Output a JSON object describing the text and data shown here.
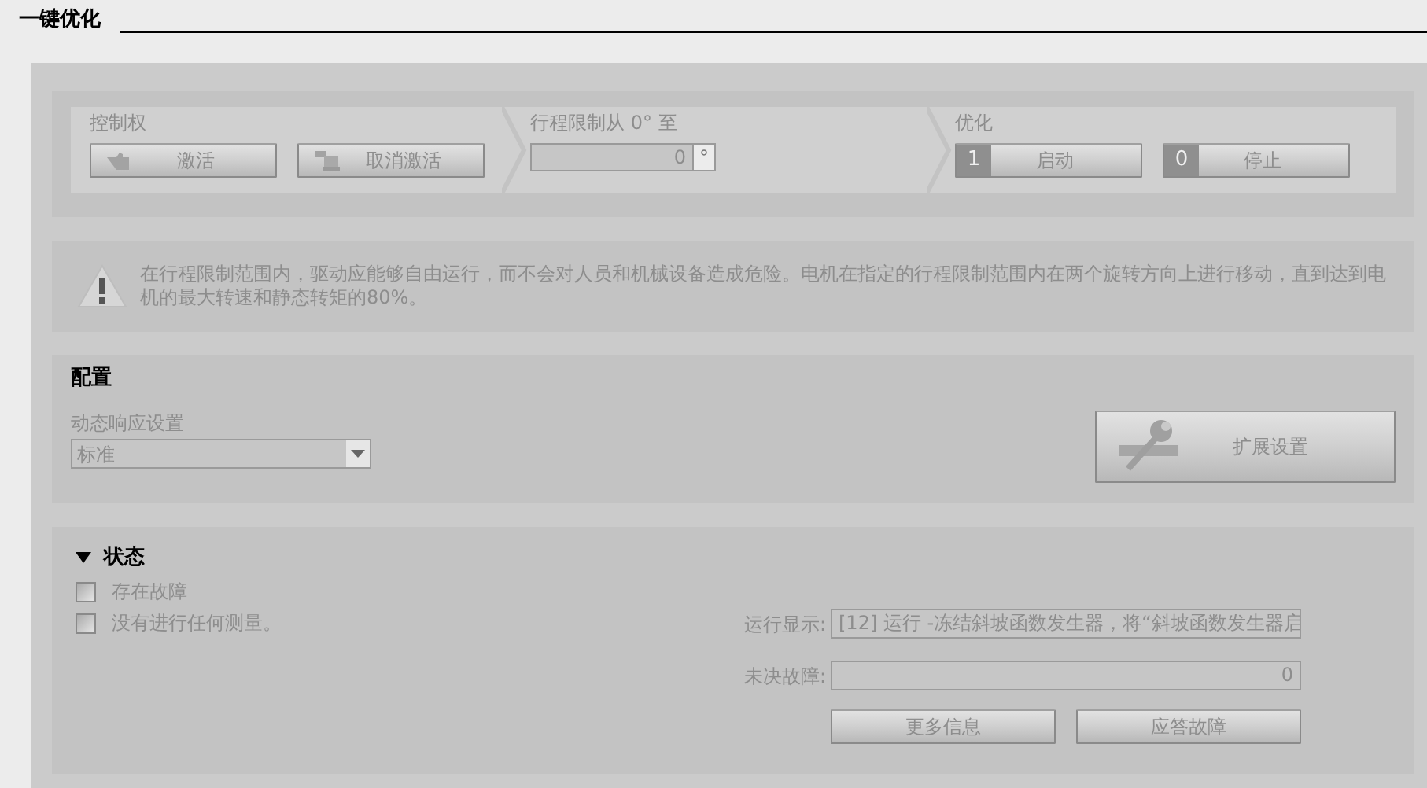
{
  "title": "一键优化",
  "steps": [
    {
      "kind": "buttons",
      "label": "控制权",
      "buttons": [
        {
          "label": "激活"
        },
        {
          "label": "取消激活"
        }
      ]
    },
    {
      "kind": "field",
      "label": "行程限制从 0° 至",
      "value": "0",
      "unit": "°"
    },
    {
      "kind": "buttons",
      "label": "优化",
      "buttons": [
        {
          "label": "启动",
          "number": "1"
        },
        {
          "label": "停止",
          "number": "0"
        }
      ]
    }
  ],
  "warning": "在行程限制范围内，驱动应能够自由运行，而不会对人员和机械设备造成危险。电机在指定的行程限制范围内在两个旋转方向上进行移动，直到达到电机的最大转速和静态转矩的80%。",
  "config": {
    "title": "配置",
    "dropdown_label": "动态响应设置",
    "dropdown_value": "标准",
    "extended_button": "扩展设置"
  },
  "status": {
    "title": "状态",
    "expanded": true,
    "checks": [
      {
        "label": "存在故障",
        "checked": false
      },
      {
        "label": "没有进行任何测量。",
        "checked": false
      }
    ],
    "fields": [
      {
        "label": "运行显示:",
        "value": "[12] 运行 -冻结斜坡函数发生器，将“斜坡函数发生器启"
      },
      {
        "label": "未决故障:",
        "value": "0"
      }
    ],
    "buttons": [
      "更多信息",
      "应答故障"
    ]
  }
}
